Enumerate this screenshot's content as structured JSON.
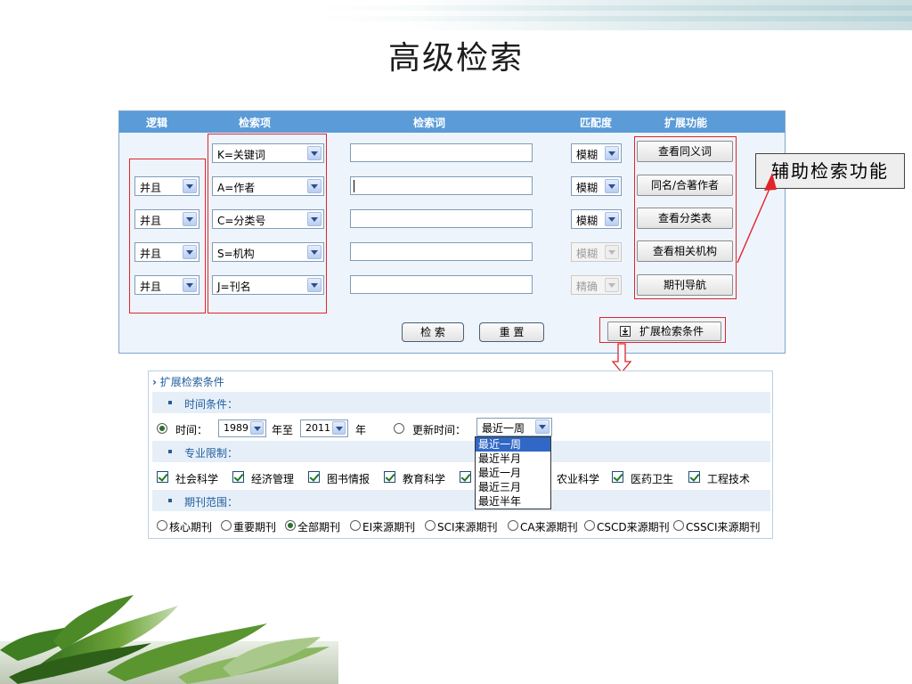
{
  "title": "高级检索",
  "header": {
    "logic": "逻辑",
    "field": "检索项",
    "term": "检索词",
    "match": "匹配度",
    "extend": "扩展功能"
  },
  "rows": [
    {
      "logic": "",
      "field": "K=关键词",
      "match": "模糊",
      "match_disabled": false,
      "action": "查看同义词"
    },
    {
      "logic": "并且",
      "field": "A=作者",
      "match": "模糊",
      "match_disabled": false,
      "action": "同名/合著作者"
    },
    {
      "logic": "并且",
      "field": "C=分类号",
      "match": "模糊",
      "match_disabled": false,
      "action": "查看分类表"
    },
    {
      "logic": "并且",
      "field": "S=机构",
      "match": "模糊",
      "match_disabled": true,
      "action": "查看相关机构"
    },
    {
      "logic": "并且",
      "field": "J=刊名",
      "match": "精确",
      "match_disabled": true,
      "action": "期刊导航"
    }
  ],
  "buttons": {
    "search": "检 索",
    "reset": "重 置",
    "expand": "扩展检索条件"
  },
  "callout": "辅助检索功能",
  "extended": {
    "title": "扩展检索条件",
    "time_section": "时间条件：",
    "time_label": "时间：",
    "year_from": "1989",
    "year_to_sep": "年至",
    "year_to": "2011",
    "year_suffix": "年",
    "update_label": "更新时间：",
    "update_value": "最近一周",
    "update_options": [
      "最近一周",
      "最近半月",
      "最近一月",
      "最近三月",
      "最近半年"
    ],
    "subject_section": "专业限制：",
    "subjects": [
      "社会科学",
      "经济管理",
      "图书情报",
      "教育科学",
      "",
      "农业科学",
      "医药卫生",
      "工程技术"
    ],
    "journal_section": "期刊范围：",
    "journals": [
      "核心期刊",
      "重要期刊",
      "全部期刊",
      "EI来源期刊",
      "SCI来源期刊",
      "CA来源期刊",
      "CSCD来源期刊",
      "CSSCI来源期刊"
    ],
    "journal_selected": "全部期刊"
  },
  "colors": {
    "header_blue": "#5a9bd8",
    "highlight_red": "#e0242c",
    "section_text": "#215e9d"
  }
}
